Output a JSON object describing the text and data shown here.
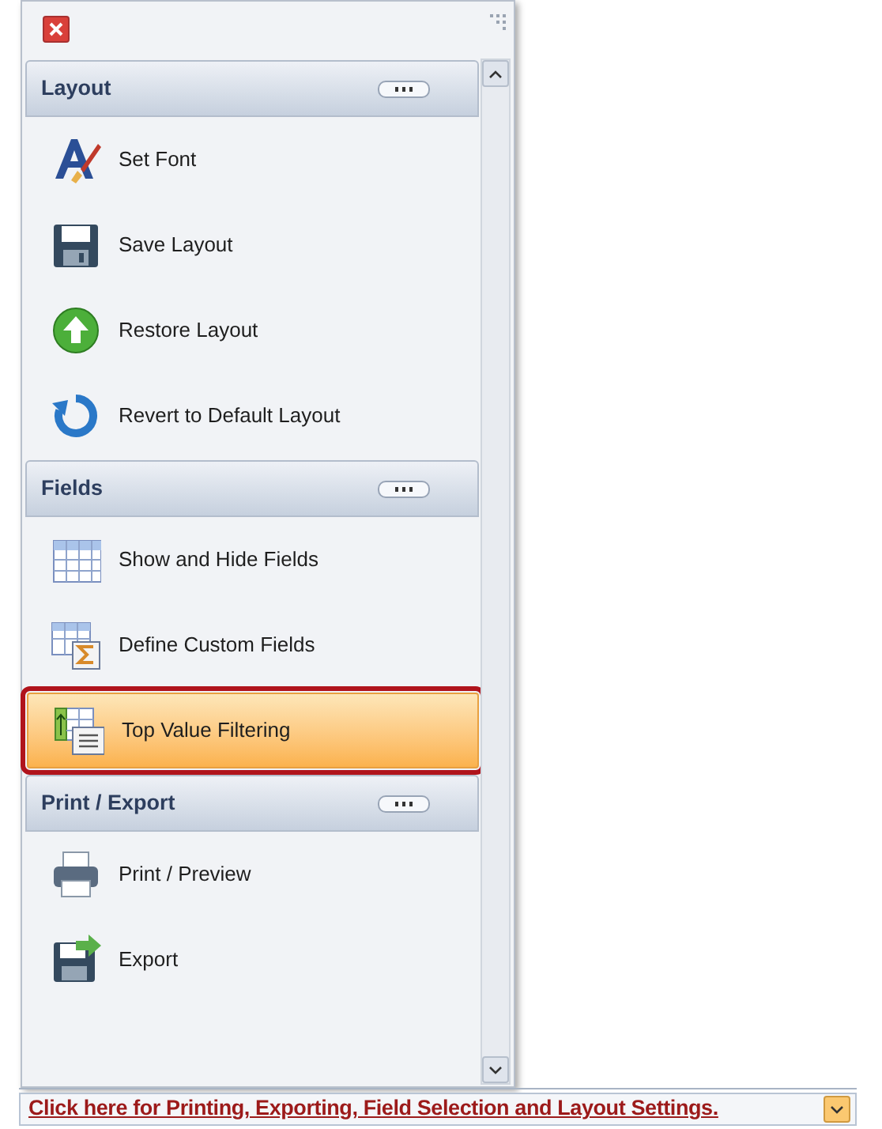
{
  "groups": [
    {
      "title": "Layout",
      "items": [
        {
          "label": "Set Font",
          "selected": false
        },
        {
          "label": "Save Layout",
          "selected": false
        },
        {
          "label": "Restore Layout",
          "selected": false
        },
        {
          "label": "Revert to Default Layout",
          "selected": false
        }
      ]
    },
    {
      "title": "Fields",
      "items": [
        {
          "label": "Show and Hide Fields",
          "selected": false
        },
        {
          "label": "Define Custom Fields",
          "selected": false
        },
        {
          "label": "Top Value Filtering",
          "selected": true
        }
      ]
    },
    {
      "title": "Print / Export",
      "items": [
        {
          "label": "Print / Preview",
          "selected": false
        },
        {
          "label": "Export",
          "selected": false
        }
      ]
    }
  ],
  "footer_link": "Click here for Printing, Exporting, Field Selection and Layout Settings."
}
